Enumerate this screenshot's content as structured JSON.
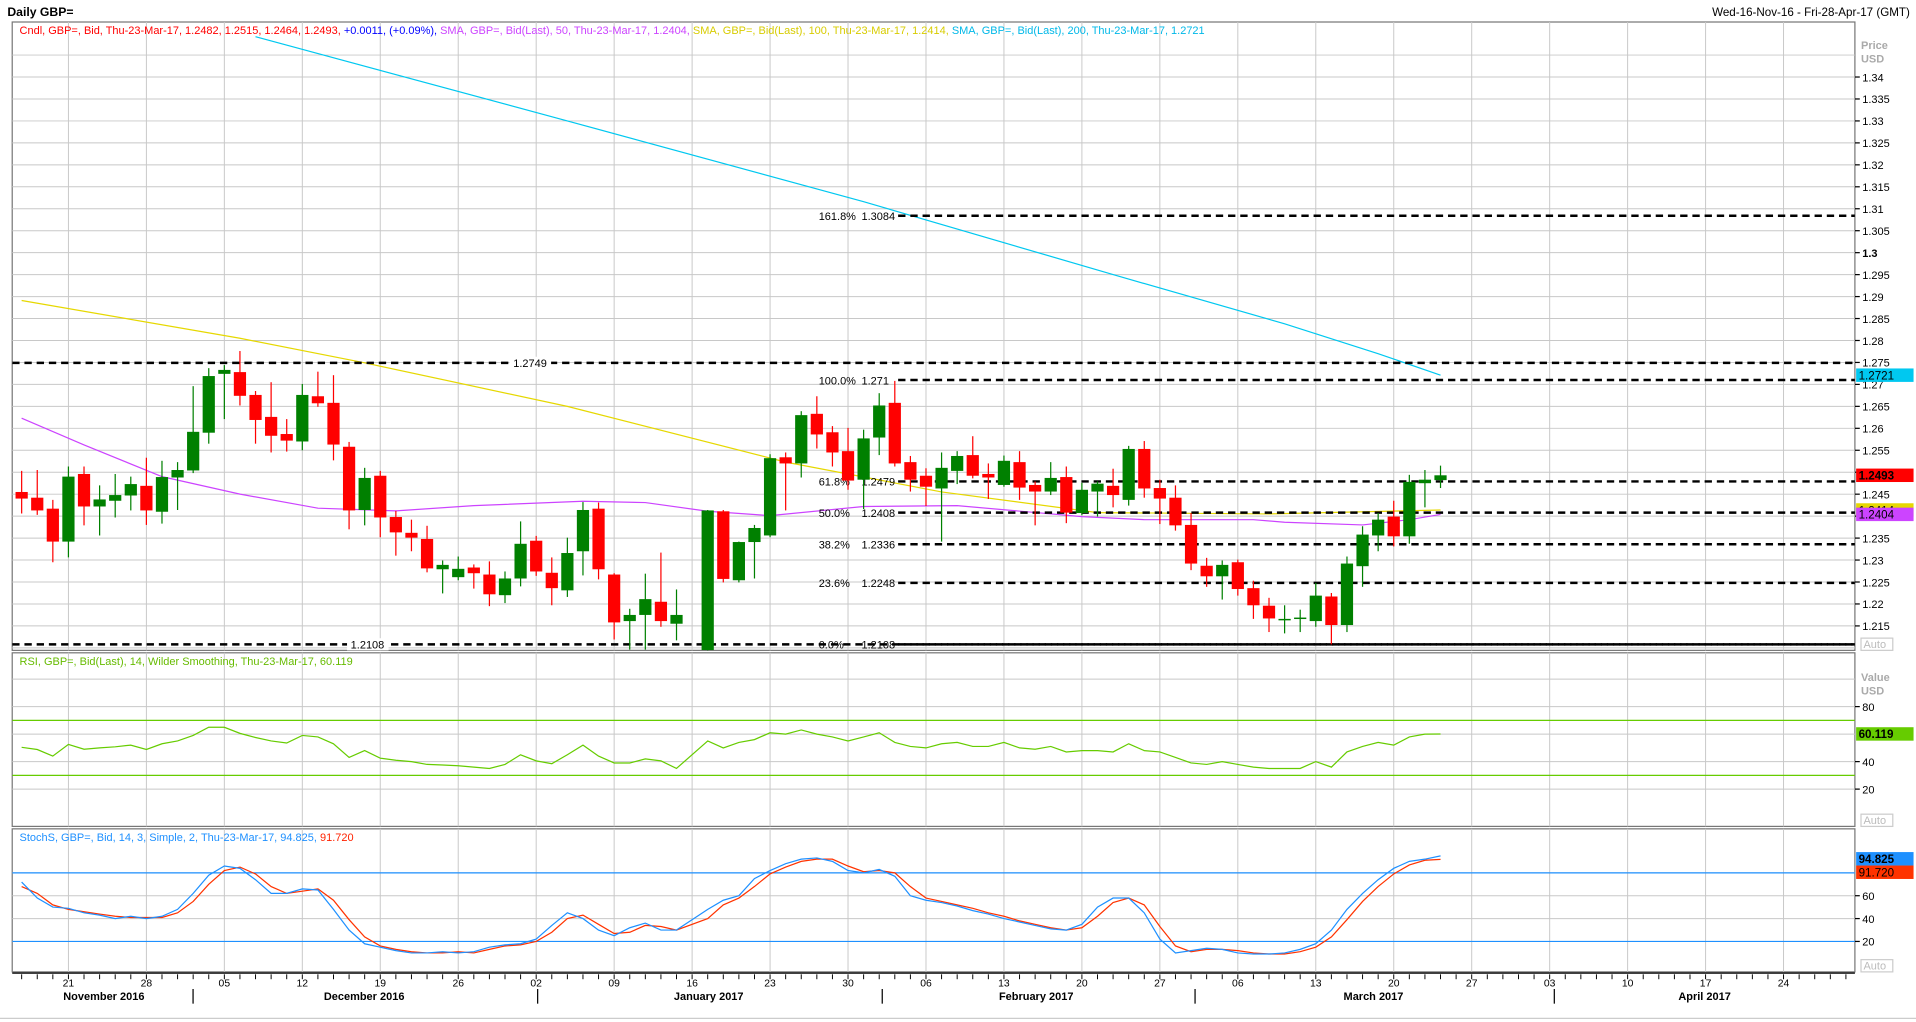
{
  "header": {
    "title": "Daily GBP=",
    "date_range": "Wed-16-Nov-16 - Fri-28-Apr-17 (GMT)"
  },
  "price_panel": {
    "legend": [
      {
        "t": "Cndl, GBP=, Bid, Thu-23-Mar-17, 1.2482, 1.2515, 1.2464, 1.2493, ",
        "c": "#ff0000"
      },
      {
        "t": "+0.0011, (+0.09%),",
        "c": "#0000ff"
      },
      {
        "t": " SMA, GBP=, Bid(Last),  50, Thu-23-Mar-17, 1.2404,",
        "c": "#cc44ff"
      },
      {
        "t": " SMA, GBP=, Bid(Last),  100, Thu-23-Mar-17, 1.2414,",
        "c": "#d8cc00"
      },
      {
        "t": " SMA, GBP=, Bid(Last),  200, Thu-23-Mar-17, 1.2721",
        "c": "#00b8e8"
      }
    ],
    "axis_title": [
      "Price",
      "USD"
    ],
    "auto_label": "Auto",
    "ticks": [
      "1.34",
      "1.335",
      "1.33",
      "1.325",
      "1.32",
      "1.315",
      "1.31",
      "1.305",
      "1.3",
      "1.295",
      "1.29",
      "1.285",
      "1.28",
      "1.275",
      "1.27",
      "1.265",
      "1.26",
      "1.255",
      "1.25",
      "1.245",
      "1.24",
      "1.235",
      "1.23",
      "1.225",
      "1.22",
      "1.215"
    ],
    "badges": [
      {
        "label": "1.2721",
        "value": 1.2721,
        "color": "#00c8f0"
      },
      {
        "label": "1.2493",
        "value": 1.2493,
        "color": "#ff0000"
      },
      {
        "label": "1.2414",
        "value": 1.2414,
        "color": "#e6d800"
      },
      {
        "label": "1.2404",
        "value": 1.2404,
        "color": "#cc44ff"
      }
    ],
    "level_lines": [
      {
        "label": "1.2749",
        "value": 1.2749
      },
      {
        "label": "1.2108",
        "value": 1.2108
      }
    ],
    "fib_levels": [
      {
        "pct": "161.8%",
        "label": "1.3084",
        "value": 1.3084
      },
      {
        "pct": "100.0%",
        "label": "1.271",
        "value": 1.271
      },
      {
        "pct": "61.8%",
        "label": "1.2479",
        "value": 1.2479
      },
      {
        "pct": "50.0%",
        "label": "1.2408",
        "value": 1.2408
      },
      {
        "pct": "38.2%",
        "label": "1.2336",
        "value": 1.2336
      },
      {
        "pct": "23.6%",
        "label": "1.2248",
        "value": 1.2248
      },
      {
        "pct": "0.0%",
        "label": "1.2108",
        "value": 1.2108
      }
    ]
  },
  "rsi_panel": {
    "legend": "RSI, GBP=, Bid(Last),  14, Wilder Smoothing, Thu-23-Mar-17, 60.119",
    "axis_title": [
      "Value",
      "USD"
    ],
    "ticks": [
      "80",
      "40",
      "20"
    ],
    "badge": "60.119",
    "auto_label": "Auto"
  },
  "stoch_panel": {
    "legend": "StochS, GBP=, Bid,  14, 3, Simple, 2, Thu-23-Mar-17, 94.825, ",
    "legend_d": "91.720",
    "ticks": [
      "60",
      "40",
      "20"
    ],
    "badge_k": "94.825",
    "badge_d": "91.720",
    "auto_label": "Auto"
  },
  "x_axis": {
    "day_labels": [
      "21",
      "28",
      "05",
      "12",
      "19",
      "26",
      "02",
      "09",
      "16",
      "23",
      "30",
      "06",
      "13",
      "20",
      "27",
      "06",
      "13",
      "20",
      "27",
      "03",
      "10",
      "17",
      "24"
    ],
    "months": [
      "November 2016",
      "December 2016",
      "January 2017",
      "February 2017",
      "March 2017",
      "April 2017"
    ]
  },
  "chart_data": {
    "type": "candlestick",
    "title": "Daily GBP=",
    "x_start": "2016-11-16",
    "x_end": "2017-03-23",
    "note": "one entry per weekday; null = no trading (16-Jan-17)",
    "ylim": [
      1.209,
      1.3445
    ],
    "colors": {
      "up": "#008000",
      "down": "#ff0000",
      "sma50": "#cc44ff",
      "sma100": "#e6d800",
      "sma200": "#00c8f0",
      "rsi": "#66cc00",
      "stoch_k": "#1e90ff",
      "stoch_d": "#ff3300"
    },
    "ohlc": [
      [
        1.2455,
        1.2503,
        1.2406,
        1.244
      ],
      [
        1.2442,
        1.2505,
        1.2403,
        1.2413
      ],
      [
        1.2417,
        1.2437,
        1.2295,
        1.2342
      ],
      [
        1.2342,
        1.2513,
        1.2306,
        1.249
      ],
      [
        1.2496,
        1.2513,
        1.2379,
        1.2422
      ],
      [
        1.2422,
        1.247,
        1.2356,
        1.2438
      ],
      [
        1.2435,
        1.2496,
        1.2397,
        1.2448
      ],
      [
        1.2447,
        1.249,
        1.2413,
        1.2473
      ],
      [
        1.2469,
        1.2533,
        1.238,
        1.2413
      ],
      [
        1.241,
        1.2526,
        1.2383,
        1.2489
      ],
      [
        1.2488,
        1.2523,
        1.2414,
        1.2505
      ],
      [
        1.2504,
        1.2696,
        1.2498,
        1.2592
      ],
      [
        1.259,
        1.2737,
        1.2565,
        1.2719
      ],
      [
        1.2724,
        1.2744,
        1.2621,
        1.2733
      ],
      [
        1.2728,
        1.2776,
        1.2652,
        1.2674
      ],
      [
        1.2676,
        1.2685,
        1.2565,
        1.2619
      ],
      [
        1.2626,
        1.2705,
        1.2545,
        1.2583
      ],
      [
        1.2587,
        1.2621,
        1.2547,
        1.2572
      ],
      [
        1.257,
        1.2701,
        1.255,
        1.2676
      ],
      [
        1.2673,
        1.2729,
        1.2649,
        1.2657
      ],
      [
        1.2658,
        1.2721,
        1.2527,
        1.2563
      ],
      [
        1.2558,
        1.2569,
        1.237,
        1.2413
      ],
      [
        1.2414,
        1.251,
        1.2379,
        1.2487
      ],
      [
        1.2492,
        1.2503,
        1.2352,
        1.2397
      ],
      [
        1.2398,
        1.2412,
        1.231,
        1.2363
      ],
      [
        1.2362,
        1.2392,
        1.232,
        1.2351
      ],
      [
        1.2348,
        1.2378,
        1.2272,
        1.2281
      ],
      [
        1.2279,
        1.2299,
        1.2224,
        1.2289
      ],
      [
        1.2261,
        1.2308,
        1.2254,
        1.228
      ],
      [
        1.2283,
        1.229,
        1.2235,
        1.227
      ],
      [
        1.2267,
        1.2297,
        1.2195,
        1.2222
      ],
      [
        1.222,
        1.2274,
        1.2202,
        1.2258
      ],
      [
        1.2258,
        1.2388,
        1.224,
        1.2337
      ],
      [
        1.2344,
        1.2355,
        1.2264,
        1.2274
      ],
      [
        1.2271,
        1.2306,
        1.2197,
        1.2236
      ],
      [
        1.2231,
        1.2351,
        1.2216,
        1.2316
      ],
      [
        1.232,
        1.2432,
        1.2265,
        1.2414
      ],
      [
        1.2417,
        1.2431,
        1.2256,
        1.2279
      ],
      [
        1.2267,
        1.227,
        1.2119,
        1.2158
      ],
      [
        1.2161,
        1.2189,
        1.2096,
        1.2175
      ],
      [
        1.2175,
        1.2269,
        1.2096,
        1.2211
      ],
      [
        1.2205,
        1.2317,
        1.2148,
        1.2161
      ],
      [
        1.2155,
        1.2233,
        1.2117,
        1.2175
      ],
      null,
      [
        1.2095,
        1.2414,
        1.2089,
        1.2413
      ],
      [
        1.2411,
        1.2414,
        1.2249,
        1.2257
      ],
      [
        1.2254,
        1.2342,
        1.2249,
        1.2341
      ],
      [
        1.2341,
        1.238,
        1.2258,
        1.2373
      ],
      [
        1.2356,
        1.2541,
        1.2352,
        1.2532
      ],
      [
        1.2534,
        1.2545,
        1.2413,
        1.252
      ],
      [
        1.252,
        1.2639,
        1.2488,
        1.263
      ],
      [
        1.2633,
        1.2673,
        1.2554,
        1.2586
      ],
      [
        1.2591,
        1.2605,
        1.2513,
        1.2545
      ],
      [
        1.2548,
        1.2601,
        1.246,
        1.2481
      ],
      [
        1.2483,
        1.2597,
        1.2416,
        1.2577
      ],
      [
        1.2579,
        1.268,
        1.2539,
        1.2652
      ],
      [
        1.2658,
        1.2708,
        1.2513,
        1.252
      ],
      [
        1.2523,
        1.2537,
        1.2456,
        1.2483
      ],
      [
        1.2492,
        1.2509,
        1.2423,
        1.2467
      ],
      [
        1.2463,
        1.2545,
        1.2342,
        1.251
      ],
      [
        1.2503,
        1.2548,
        1.2473,
        1.2537
      ],
      [
        1.2539,
        1.2582,
        1.2486,
        1.2492
      ],
      [
        1.2496,
        1.252,
        1.2439,
        1.2488
      ],
      [
        1.2471,
        1.2538,
        1.2467,
        1.2526
      ],
      [
        1.2523,
        1.2548,
        1.2437,
        1.2465
      ],
      [
        1.2471,
        1.2479,
        1.2379,
        1.2456
      ],
      [
        1.2456,
        1.2523,
        1.2448,
        1.2487
      ],
      [
        1.2489,
        1.2513,
        1.2384,
        1.2408
      ],
      [
        1.2407,
        1.2476,
        1.2402,
        1.246
      ],
      [
        1.2456,
        1.2479,
        1.2399,
        1.2474
      ],
      [
        1.2469,
        1.2508,
        1.242,
        1.2448
      ],
      [
        1.2437,
        1.256,
        1.2424,
        1.2553
      ],
      [
        1.2553,
        1.2571,
        1.2442,
        1.2463
      ],
      [
        1.2464,
        1.2483,
        1.2382,
        1.244
      ],
      [
        1.2442,
        1.247,
        1.2367,
        1.2379
      ],
      [
        1.238,
        1.2407,
        1.2277,
        1.2292
      ],
      [
        1.2287,
        1.2305,
        1.2239,
        1.2263
      ],
      [
        1.2263,
        1.2299,
        1.221,
        1.2289
      ],
      [
        1.2295,
        1.2301,
        1.2219,
        1.2234
      ],
      [
        1.2236,
        1.2253,
        1.2166,
        1.2197
      ],
      [
        1.2196,
        1.2214,
        1.2136,
        1.2167
      ],
      [
        1.2163,
        1.2197,
        1.2133,
        1.2166
      ],
      [
        1.2166,
        1.2187,
        1.2136,
        1.2169
      ],
      [
        1.2161,
        1.2248,
        1.2148,
        1.2219
      ],
      [
        1.2217,
        1.2225,
        1.2108,
        1.2152
      ],
      [
        1.2152,
        1.2308,
        1.2136,
        1.2292
      ],
      [
        1.2286,
        1.2377,
        1.2239,
        1.2358
      ],
      [
        1.2356,
        1.2407,
        1.232,
        1.2392
      ],
      [
        1.2399,
        1.2435,
        1.2331,
        1.2354
      ],
      [
        1.2354,
        1.2494,
        1.2337,
        1.2478
      ],
      [
        1.2475,
        1.2505,
        1.242,
        1.2483
      ],
      [
        1.2482,
        1.2515,
        1.2464,
        1.2493
      ]
    ],
    "sma50": [
      [
        0,
        1.2623
      ],
      [
        4,
        1.2562
      ],
      [
        9,
        1.249
      ],
      [
        14,
        1.245
      ],
      [
        19,
        1.2418
      ],
      [
        24,
        1.2412
      ],
      [
        29,
        1.2424
      ],
      [
        36,
        1.2434
      ],
      [
        40,
        1.2431
      ],
      [
        44,
        1.2411
      ],
      [
        48,
        1.2401
      ],
      [
        54,
        1.2422
      ],
      [
        60,
        1.2424
      ],
      [
        68,
        1.2399
      ],
      [
        72,
        1.2392
      ],
      [
        79,
        1.2392
      ],
      [
        81,
        1.2386
      ],
      [
        86,
        1.238
      ],
      [
        89,
        1.2392
      ],
      [
        91,
        1.2404
      ]
    ],
    "sma100": [
      [
        0,
        1.2891
      ],
      [
        14,
        1.2805
      ],
      [
        22,
        1.2749
      ],
      [
        35,
        1.265
      ],
      [
        49,
        1.2523
      ],
      [
        59,
        1.2455
      ],
      [
        69,
        1.2408
      ],
      [
        80,
        1.2405
      ],
      [
        91,
        1.2414
      ]
    ],
    "sma200": [
      [
        15,
        1.3492
      ],
      [
        35,
        1.33
      ],
      [
        54,
        1.3116
      ],
      [
        70,
        1.295
      ],
      [
        81,
        1.2838
      ],
      [
        87,
        1.277
      ],
      [
        91,
        1.2721
      ]
    ],
    "rsi": {
      "ylim": [
        0,
        100
      ],
      "bands": [
        70,
        30
      ],
      "values": [
        50.4,
        48.8,
        44,
        52.5,
        49,
        50,
        50.8,
        52,
        48.8,
        53,
        55,
        59,
        65,
        65,
        60.5,
        57.5,
        55,
        53.5,
        59,
        58,
        53,
        43,
        48,
        42.5,
        41,
        40,
        38,
        37.5,
        37,
        36,
        35,
        38,
        45,
        40.5,
        38.5,
        45,
        52,
        44,
        39,
        39,
        42,
        40.5,
        35,
        null,
        55,
        50,
        54,
        56,
        61,
        60,
        63,
        60,
        58,
        55,
        58,
        61,
        54,
        51,
        50,
        53,
        54,
        51,
        51,
        54,
        50,
        49,
        51,
        47,
        48,
        48,
        47,
        53,
        48,
        47,
        43,
        39,
        38,
        40,
        38,
        36,
        35,
        35,
        35,
        40,
        36,
        47,
        51,
        54,
        52,
        58,
        60,
        60.119
      ]
    },
    "stoch": {
      "ylim": [
        0,
        100
      ],
      "bands": [
        80,
        20
      ],
      "k": [
        72,
        58,
        50,
        49,
        45,
        43,
        40,
        42,
        40,
        42,
        48,
        62,
        78,
        86,
        84,
        74,
        62,
        62,
        66,
        65,
        48,
        30,
        18,
        15,
        12,
        10,
        10,
        11,
        10,
        11,
        15,
        17,
        18,
        22,
        34,
        45,
        40,
        30,
        25,
        32,
        36,
        30,
        30,
        null,
        48,
        56,
        60,
        75,
        82,
        88,
        92,
        93,
        90,
        82,
        80,
        83,
        77,
        60,
        56,
        54,
        51,
        47,
        44,
        40,
        37,
        34,
        31,
        30,
        35,
        50,
        58,
        58,
        45,
        22,
        10,
        12,
        14,
        13,
        10,
        9,
        9,
        10,
        13,
        18,
        30,
        48,
        62,
        74,
        84,
        90,
        92,
        94.825
      ],
      "d": [
        68,
        62,
        52,
        48,
        46,
        44,
        42,
        41,
        41,
        41,
        45,
        55,
        70,
        82,
        85,
        79,
        68,
        62,
        64,
        66,
        56,
        39,
        24,
        16,
        13,
        11,
        10,
        10,
        11,
        10,
        13,
        16,
        17,
        20,
        28,
        40,
        43,
        35,
        27,
        28,
        34,
        33,
        30,
        null,
        40,
        52,
        58,
        68,
        79,
        85,
        90,
        92,
        92,
        86,
        81,
        82,
        80,
        68,
        58,
        55,
        52,
        49,
        45,
        42,
        38,
        35,
        32,
        30,
        32,
        42,
        54,
        58,
        52,
        33,
        16,
        11,
        13,
        13,
        12,
        10,
        9,
        9,
        11,
        15,
        24,
        39,
        55,
        68,
        79,
        87,
        91,
        91.72
      ]
    }
  }
}
